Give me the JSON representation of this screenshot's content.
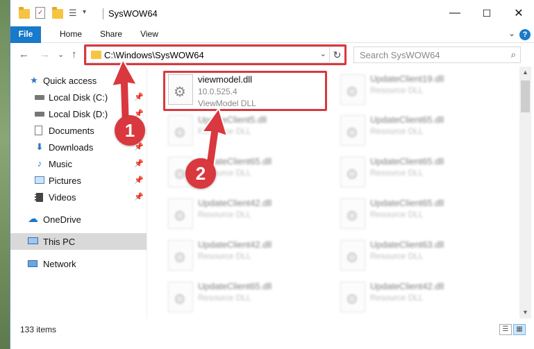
{
  "window": {
    "title": "SysWOW64",
    "controls": {
      "minimize": "—",
      "maximize": "☐",
      "close": "✕"
    }
  },
  "ribbon": {
    "tabs": [
      "File",
      "Home",
      "Share",
      "View"
    ],
    "help": "?",
    "expand": "⌄"
  },
  "navigation": {
    "back": "←",
    "forward": "→",
    "recent": "⌄",
    "up": "↑",
    "address": "C:\\Windows\\SysWOW64",
    "address_dropdown": "⌄",
    "refresh": "↻",
    "search_placeholder": "Search SysWOW64"
  },
  "sidebar": {
    "items": [
      {
        "label": "Quick access",
        "icon": "star-icon"
      },
      {
        "label": "Local Disk (C:)",
        "icon": "drive-icon",
        "pinned": true
      },
      {
        "label": "Local Disk (D:)",
        "icon": "drive-icon",
        "pinned": true
      },
      {
        "label": "Documents",
        "icon": "documents-icon",
        "pinned": true
      },
      {
        "label": "Downloads",
        "icon": "downloads-icon",
        "pinned": true
      },
      {
        "label": "Music",
        "icon": "music-icon",
        "pinned": true
      },
      {
        "label": "Pictures",
        "icon": "pictures-icon",
        "pinned": true
      },
      {
        "label": "Videos",
        "icon": "videos-icon",
        "pinned": true
      },
      {
        "label": "OneDrive",
        "icon": "cloud-icon"
      },
      {
        "label": "This PC",
        "icon": "computer-icon",
        "selected": true
      },
      {
        "label": "Network",
        "icon": "network-icon"
      }
    ]
  },
  "files": {
    "highlighted": {
      "name": "viewmodel.dll",
      "version": "10.0.525.4",
      "type": "ViewModel DLL"
    },
    "left_column": [
      {
        "name": "UpdateClient5.dll",
        "type": "Resource DLL"
      },
      {
        "name": "UpdateClient65.dll",
        "type": "Resource DLL"
      },
      {
        "name": "UpdateClient42.dll",
        "type": "Resource DLL"
      },
      {
        "name": "UpdateClient42.dll",
        "type": "Resource DLL"
      },
      {
        "name": "UpdateClient65.dll",
        "type": "Resource DLL"
      }
    ],
    "right_column": [
      {
        "name": "UpdateClient19.dll",
        "type": "Resource DLL"
      },
      {
        "name": "UpdateClient65.dll",
        "type": "Resource DLL"
      },
      {
        "name": "UpdateClient65.dll",
        "type": "Resource DLL"
      },
      {
        "name": "UpdateClient65.dll",
        "type": "Resource DLL"
      },
      {
        "name": "UpdateClient63.dll",
        "type": "Resource DLL"
      },
      {
        "name": "UpdateClient42.dll",
        "type": "Resource DLL"
      }
    ]
  },
  "status": {
    "item_count": "133 items"
  },
  "annotations": {
    "step1": "1",
    "step2": "2",
    "color": "#d9383f"
  }
}
